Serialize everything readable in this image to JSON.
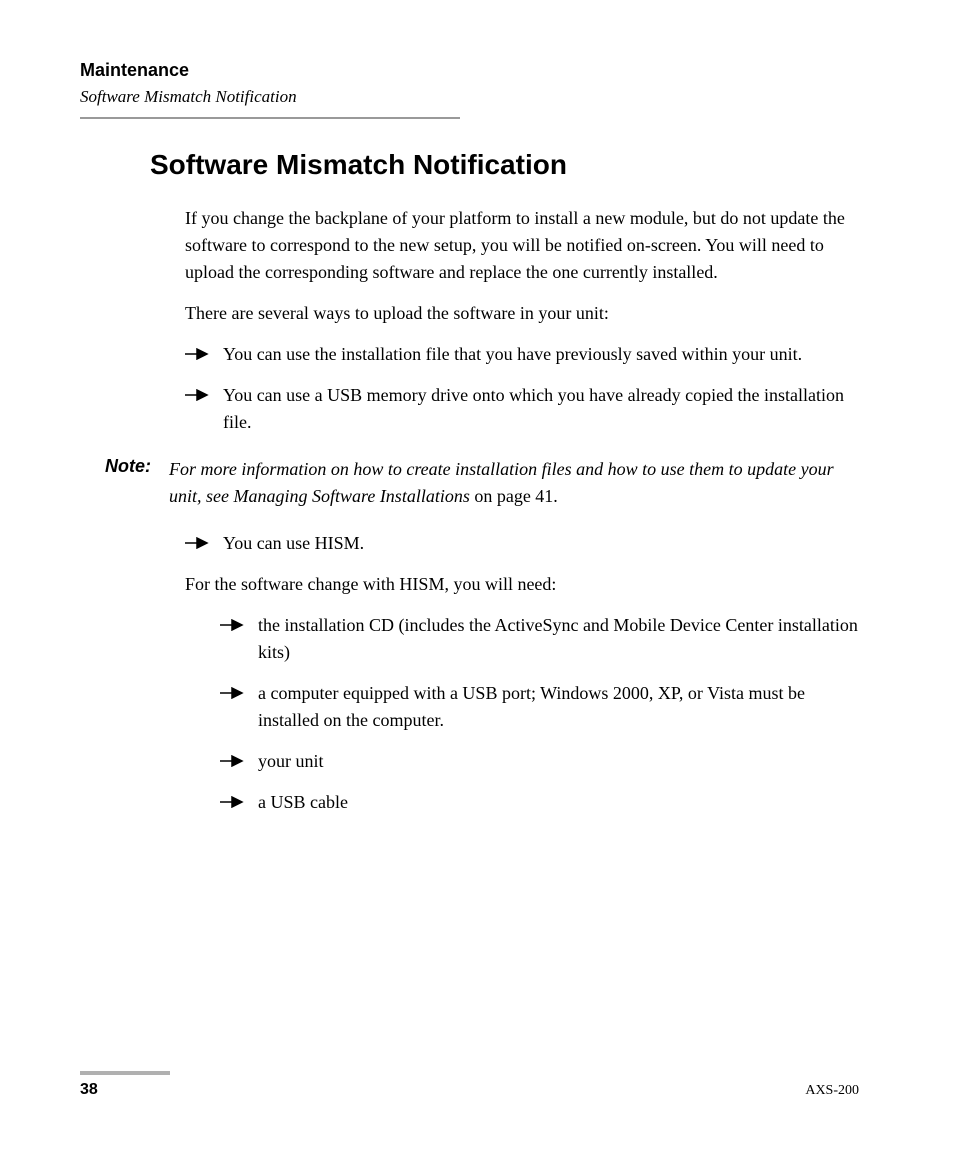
{
  "header": {
    "chapter": "Maintenance",
    "section": "Software Mismatch Notification"
  },
  "heading": "Software Mismatch Notification",
  "paragraphs": {
    "intro": "If you change the backplane of your platform to install a new module, but do not update the software to correspond to the new setup, you will be notified on-screen. You will need to upload the corresponding software and replace the one currently installed.",
    "ways": "There are several ways to upload the software in your unit:",
    "hism_need": "For the software change with HISM, you will need:"
  },
  "bullets1": [
    "You can use the installation file that you have previously saved within your unit.",
    "You can use a USB memory drive onto which you have already copied the installation file."
  ],
  "note": {
    "label": "Note:",
    "text_italic": "For more information on how to create installation files and how to use them to update your unit, see Managing Software Installations",
    "text_plain": " on page 41."
  },
  "bullets2": [
    "You can use HISM."
  ],
  "sub_bullets": [
    "the installation CD (includes the ActiveSync and Mobile Device Center installation kits)",
    "a computer equipped with a USB port; Windows 2000, XP, or Vista must be installed on the computer.",
    "your unit",
    "a USB cable"
  ],
  "footer": {
    "page": "38",
    "doc_id": "AXS-200"
  }
}
